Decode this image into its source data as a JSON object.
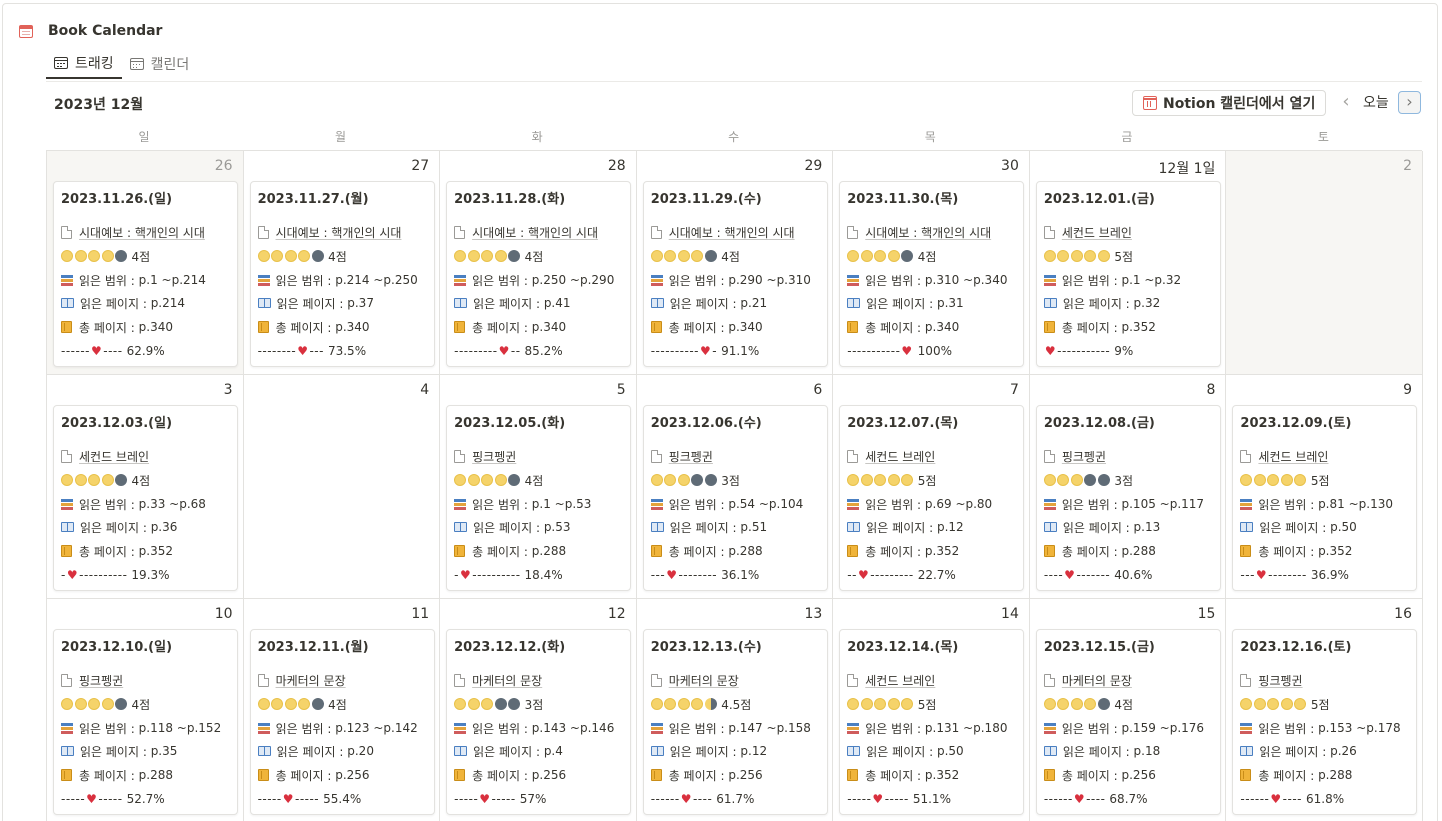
{
  "app": {
    "title": "Book Calendar"
  },
  "tabs": [
    {
      "label": "트래킹",
      "active": true
    },
    {
      "label": "캘린더",
      "active": false
    }
  ],
  "toolbar": {
    "month": "2023년 12월",
    "open_label": "Notion 캘린더에서 열기",
    "today_label": "오늘",
    "prev_icon": "chevron-left-icon",
    "next_icon": "chevron-right-icon"
  },
  "weekdays": [
    "일",
    "월",
    "화",
    "수",
    "목",
    "금",
    "토"
  ],
  "labels": {
    "range": "읽은 범위 : ",
    "read": "읽은 페이지 : ",
    "total": "총 페이지 : "
  },
  "weeks": [
    [
      {
        "day": "26",
        "muted": true,
        "card": {
          "title": "2023.11.26.(일)",
          "book": "시대예보 : 핵개인의 시대",
          "stars": "yyyyg",
          "score": "4점",
          "range": "p.1 ~p.214",
          "read": "p.214",
          "total": "p.340",
          "bar_before": "------",
          "bar_after": "----",
          "percent": "62.9%"
        }
      },
      {
        "day": "27",
        "muted": false,
        "card": {
          "title": "2023.11.27.(월)",
          "book": "시대예보 : 핵개인의 시대",
          "stars": "yyyyg",
          "score": "4점",
          "range": "p.214 ~p.250",
          "read": "p.37",
          "total": "p.340",
          "bar_before": "--------",
          "bar_after": "---",
          "percent": "73.5%"
        }
      },
      {
        "day": "28",
        "muted": false,
        "card": {
          "title": "2023.11.28.(화)",
          "book": "시대예보 : 핵개인의 시대",
          "stars": "yyyyg",
          "score": "4점",
          "range": "p.250 ~p.290",
          "read": "p.41",
          "total": "p.340",
          "bar_before": "---------",
          "bar_after": "--",
          "percent": "85.2%"
        }
      },
      {
        "day": "29",
        "muted": false,
        "card": {
          "title": "2023.11.29.(수)",
          "book": "시대예보 : 핵개인의 시대",
          "stars": "yyyyg",
          "score": "4점",
          "range": "p.290 ~p.310",
          "read": "p.21",
          "total": "p.340",
          "bar_before": "----------",
          "bar_after": "-",
          "percent": "91.1%"
        }
      },
      {
        "day": "30",
        "muted": false,
        "card": {
          "title": "2023.11.30.(목)",
          "book": "시대예보 : 핵개인의 시대",
          "stars": "yyyyg",
          "score": "4점",
          "range": "p.310 ~p.340",
          "read": "p.31",
          "total": "p.340",
          "bar_before": "-----------",
          "bar_after": "",
          "percent": "100%"
        }
      },
      {
        "day": "12월 1일",
        "muted": false,
        "card": {
          "title": "2023.12.01.(금)",
          "book": "세컨드 브레인",
          "stars": "yyyyy",
          "score": "5점",
          "range": "p.1 ~p.32",
          "read": "p.32",
          "total": "p.352",
          "bar_before": "",
          "bar_after": "-----------",
          "percent": "9%"
        }
      },
      {
        "day": "2",
        "muted": true,
        "card": null
      }
    ],
    [
      {
        "day": "3",
        "muted": false,
        "card": {
          "title": "2023.12.03.(일)",
          "book": "세컨드 브레인",
          "stars": "yyyyg",
          "score": "4점",
          "range": "p.33 ~p.68",
          "read": "p.36",
          "total": "p.352",
          "bar_before": "-",
          "bar_after": "----------",
          "percent": "19.3%"
        }
      },
      {
        "day": "4",
        "muted": false,
        "card": null
      },
      {
        "day": "5",
        "muted": false,
        "card": {
          "title": "2023.12.05.(화)",
          "book": "핑크펭귄",
          "stars": "yyyyg",
          "score": "4점",
          "range": "p.1 ~p.53",
          "read": "p.53",
          "total": "p.288",
          "bar_before": "-",
          "bar_after": "----------",
          "percent": "18.4%"
        }
      },
      {
        "day": "6",
        "muted": false,
        "card": {
          "title": "2023.12.06.(수)",
          "book": "핑크펭귄",
          "stars": "yyygg",
          "score": "3점",
          "range": "p.54 ~p.104",
          "read": "p.51",
          "total": "p.288",
          "bar_before": "---",
          "bar_after": "--------",
          "percent": "36.1%"
        }
      },
      {
        "day": "7",
        "muted": false,
        "card": {
          "title": "2023.12.07.(목)",
          "book": "세컨드 브레인",
          "stars": "yyyyy",
          "score": "5점",
          "range": "p.69 ~p.80",
          "read": "p.12",
          "total": "p.352",
          "bar_before": "--",
          "bar_after": "---------",
          "percent": "22.7%"
        }
      },
      {
        "day": "8",
        "muted": false,
        "card": {
          "title": "2023.12.08.(금)",
          "book": "핑크펭귄",
          "stars": "yyygg",
          "score": "3점",
          "range": "p.105 ~p.117",
          "read": "p.13",
          "total": "p.288",
          "bar_before": "----",
          "bar_after": "-------",
          "percent": "40.6%"
        }
      },
      {
        "day": "9",
        "muted": false,
        "card": {
          "title": "2023.12.09.(토)",
          "book": "세컨드 브레인",
          "stars": "yyyyy",
          "score": "5점",
          "range": "p.81 ~p.130",
          "read": "p.50",
          "total": "p.352",
          "bar_before": "---",
          "bar_after": "--------",
          "percent": "36.9%"
        }
      }
    ],
    [
      {
        "day": "10",
        "muted": false,
        "card": {
          "title": "2023.12.10.(일)",
          "book": "핑크펭귄",
          "stars": "yyyyg",
          "score": "4점",
          "range": "p.118 ~p.152",
          "read": "p.35",
          "total": "p.288",
          "bar_before": "-----",
          "bar_after": "-----",
          "percent": "52.7%"
        }
      },
      {
        "day": "11",
        "muted": false,
        "card": {
          "title": "2023.12.11.(월)",
          "book": "마케터의 문장",
          "stars": "yyyyg",
          "score": "4점",
          "range": "p.123 ~p.142",
          "read": "p.20",
          "total": "p.256",
          "bar_before": "-----",
          "bar_after": "-----",
          "percent": "55.4%"
        }
      },
      {
        "day": "12",
        "muted": false,
        "card": {
          "title": "2023.12.12.(화)",
          "book": "마케터의 문장",
          "stars": "yyygg",
          "score": "3점",
          "range": "p.143 ~p.146",
          "read": "p.4",
          "total": "p.256",
          "bar_before": "-----",
          "bar_after": "-----",
          "percent": "57%"
        }
      },
      {
        "day": "13",
        "muted": false,
        "card": {
          "title": "2023.12.13.(수)",
          "book": "마케터의 문장",
          "stars": "yyyyh",
          "score": "4.5점",
          "range": "p.147 ~p.158",
          "read": "p.12",
          "total": "p.256",
          "bar_before": "------",
          "bar_after": "----",
          "percent": "61.7%"
        }
      },
      {
        "day": "14",
        "muted": false,
        "card": {
          "title": "2023.12.14.(목)",
          "book": "세컨드 브레인",
          "stars": "yyyyy",
          "score": "5점",
          "range": "p.131 ~p.180",
          "read": "p.50",
          "total": "p.352",
          "bar_before": "-----",
          "bar_after": "-----",
          "percent": "51.1%"
        }
      },
      {
        "day": "15",
        "muted": false,
        "card": {
          "title": "2023.12.15.(금)",
          "book": "마케터의 문장",
          "stars": "yyyyg",
          "score": "4점",
          "range": "p.159 ~p.176",
          "read": "p.18",
          "total": "p.256",
          "bar_before": "------",
          "bar_after": "----",
          "percent": "68.7%"
        }
      },
      {
        "day": "16",
        "muted": false,
        "card": {
          "title": "2023.12.16.(토)",
          "book": "핑크펭귄",
          "stars": "yyyyy",
          "score": "5점",
          "range": "p.153 ~p.178",
          "read": "p.26",
          "total": "p.288",
          "bar_before": "------",
          "bar_after": "----",
          "percent": "61.8%"
        }
      }
    ]
  ]
}
